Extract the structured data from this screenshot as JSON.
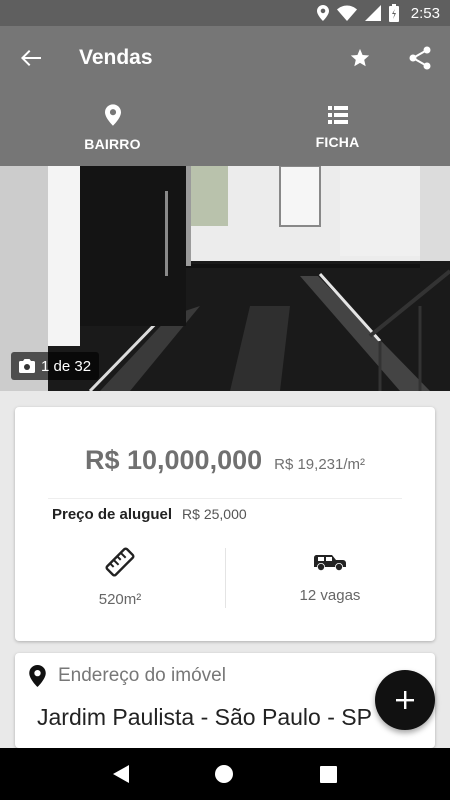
{
  "status_bar": {
    "time": "2:53",
    "icons": [
      "location-icon",
      "wifi-icon",
      "signal-icon",
      "battery-icon"
    ]
  },
  "app_bar": {
    "title": "Vendas",
    "icons": [
      "back-arrow-icon",
      "star-icon",
      "share-icon"
    ]
  },
  "tabs": [
    {
      "label": "BAIRRO",
      "icon": "location-pin-icon"
    },
    {
      "label": "FICHA",
      "icon": "list-icon"
    }
  ],
  "photo": {
    "counter": "1 de 32",
    "icon": "camera-icon"
  },
  "listing": {
    "price": "R$ 10,000,000",
    "price_per_m2": "R$ 19,231/m²",
    "rent_label": "Preço de aluguel",
    "rent_value": "R$ 25,000",
    "area": "520m²",
    "area_icon": "ruler-icon",
    "parking": "12 vagas",
    "parking_icon": "car-icon"
  },
  "address": {
    "label": "Endereço do imóvel",
    "value": "Jardim Paulista - São Paulo - SP",
    "icon": "location-pin-icon"
  },
  "fab": {
    "icon": "plus-icon"
  },
  "nav_bar": {
    "icons": [
      "back-triangle-icon",
      "home-circle-icon",
      "recents-square-icon"
    ]
  },
  "colors": {
    "app_bar": "#767676",
    "status_bar": "#5f5f5f",
    "fab": "#111111",
    "price_text": "#707070"
  }
}
